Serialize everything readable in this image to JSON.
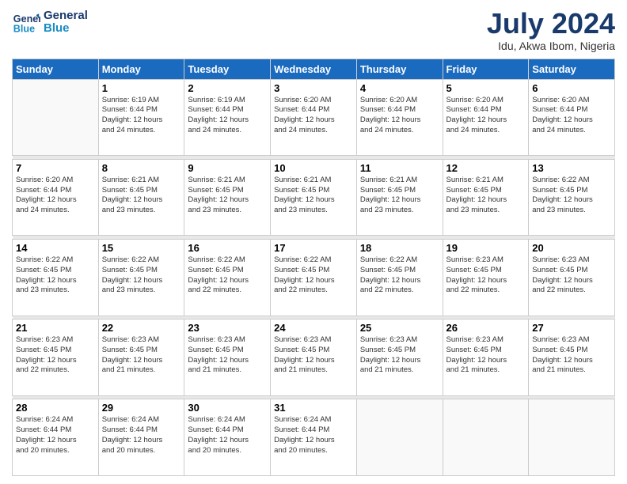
{
  "header": {
    "logo_line1": "General",
    "logo_line2": "Blue",
    "month_title": "July 2024",
    "location": "Idu, Akwa Ibom, Nigeria"
  },
  "weekdays": [
    "Sunday",
    "Monday",
    "Tuesday",
    "Wednesday",
    "Thursday",
    "Friday",
    "Saturday"
  ],
  "weeks": [
    [
      {
        "day": "",
        "info": ""
      },
      {
        "day": "1",
        "info": "Sunrise: 6:19 AM\nSunset: 6:44 PM\nDaylight: 12 hours\nand 24 minutes."
      },
      {
        "day": "2",
        "info": "Sunrise: 6:19 AM\nSunset: 6:44 PM\nDaylight: 12 hours\nand 24 minutes."
      },
      {
        "day": "3",
        "info": "Sunrise: 6:20 AM\nSunset: 6:44 PM\nDaylight: 12 hours\nand 24 minutes."
      },
      {
        "day": "4",
        "info": "Sunrise: 6:20 AM\nSunset: 6:44 PM\nDaylight: 12 hours\nand 24 minutes."
      },
      {
        "day": "5",
        "info": "Sunrise: 6:20 AM\nSunset: 6:44 PM\nDaylight: 12 hours\nand 24 minutes."
      },
      {
        "day": "6",
        "info": "Sunrise: 6:20 AM\nSunset: 6:44 PM\nDaylight: 12 hours\nand 24 minutes."
      }
    ],
    [
      {
        "day": "7",
        "info": "Sunrise: 6:20 AM\nSunset: 6:44 PM\nDaylight: 12 hours\nand 24 minutes."
      },
      {
        "day": "8",
        "info": "Sunrise: 6:21 AM\nSunset: 6:45 PM\nDaylight: 12 hours\nand 23 minutes."
      },
      {
        "day": "9",
        "info": "Sunrise: 6:21 AM\nSunset: 6:45 PM\nDaylight: 12 hours\nand 23 minutes."
      },
      {
        "day": "10",
        "info": "Sunrise: 6:21 AM\nSunset: 6:45 PM\nDaylight: 12 hours\nand 23 minutes."
      },
      {
        "day": "11",
        "info": "Sunrise: 6:21 AM\nSunset: 6:45 PM\nDaylight: 12 hours\nand 23 minutes."
      },
      {
        "day": "12",
        "info": "Sunrise: 6:21 AM\nSunset: 6:45 PM\nDaylight: 12 hours\nand 23 minutes."
      },
      {
        "day": "13",
        "info": "Sunrise: 6:22 AM\nSunset: 6:45 PM\nDaylight: 12 hours\nand 23 minutes."
      }
    ],
    [
      {
        "day": "14",
        "info": "Sunrise: 6:22 AM\nSunset: 6:45 PM\nDaylight: 12 hours\nand 23 minutes."
      },
      {
        "day": "15",
        "info": "Sunrise: 6:22 AM\nSunset: 6:45 PM\nDaylight: 12 hours\nand 23 minutes."
      },
      {
        "day": "16",
        "info": "Sunrise: 6:22 AM\nSunset: 6:45 PM\nDaylight: 12 hours\nand 22 minutes."
      },
      {
        "day": "17",
        "info": "Sunrise: 6:22 AM\nSunset: 6:45 PM\nDaylight: 12 hours\nand 22 minutes."
      },
      {
        "day": "18",
        "info": "Sunrise: 6:22 AM\nSunset: 6:45 PM\nDaylight: 12 hours\nand 22 minutes."
      },
      {
        "day": "19",
        "info": "Sunrise: 6:23 AM\nSunset: 6:45 PM\nDaylight: 12 hours\nand 22 minutes."
      },
      {
        "day": "20",
        "info": "Sunrise: 6:23 AM\nSunset: 6:45 PM\nDaylight: 12 hours\nand 22 minutes."
      }
    ],
    [
      {
        "day": "21",
        "info": "Sunrise: 6:23 AM\nSunset: 6:45 PM\nDaylight: 12 hours\nand 22 minutes."
      },
      {
        "day": "22",
        "info": "Sunrise: 6:23 AM\nSunset: 6:45 PM\nDaylight: 12 hours\nand 21 minutes."
      },
      {
        "day": "23",
        "info": "Sunrise: 6:23 AM\nSunset: 6:45 PM\nDaylight: 12 hours\nand 21 minutes."
      },
      {
        "day": "24",
        "info": "Sunrise: 6:23 AM\nSunset: 6:45 PM\nDaylight: 12 hours\nand 21 minutes."
      },
      {
        "day": "25",
        "info": "Sunrise: 6:23 AM\nSunset: 6:45 PM\nDaylight: 12 hours\nand 21 minutes."
      },
      {
        "day": "26",
        "info": "Sunrise: 6:23 AM\nSunset: 6:45 PM\nDaylight: 12 hours\nand 21 minutes."
      },
      {
        "day": "27",
        "info": "Sunrise: 6:23 AM\nSunset: 6:45 PM\nDaylight: 12 hours\nand 21 minutes."
      }
    ],
    [
      {
        "day": "28",
        "info": "Sunrise: 6:24 AM\nSunset: 6:44 PM\nDaylight: 12 hours\nand 20 minutes."
      },
      {
        "day": "29",
        "info": "Sunrise: 6:24 AM\nSunset: 6:44 PM\nDaylight: 12 hours\nand 20 minutes."
      },
      {
        "day": "30",
        "info": "Sunrise: 6:24 AM\nSunset: 6:44 PM\nDaylight: 12 hours\nand 20 minutes."
      },
      {
        "day": "31",
        "info": "Sunrise: 6:24 AM\nSunset: 6:44 PM\nDaylight: 12 hours\nand 20 minutes."
      },
      {
        "day": "",
        "info": ""
      },
      {
        "day": "",
        "info": ""
      },
      {
        "day": "",
        "info": ""
      }
    ]
  ]
}
